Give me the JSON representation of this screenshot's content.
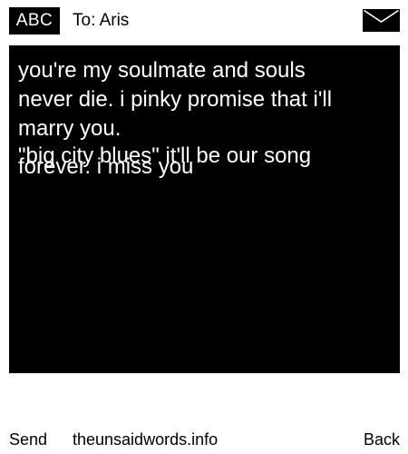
{
  "header": {
    "input_mode": "ABC",
    "recipient": "To: Aris"
  },
  "message": {
    "line_1": "you're my soulmate and souls",
    "line_2": "never die. i pinky promise that i'll",
    "line_3": "marry you.",
    "line_4": "forever. i miss you",
    "overlap_line": "\"big city blues\" it'll be our song"
  },
  "footer": {
    "send_label": "Send",
    "site": "theunsaidwords.info",
    "back_label": "Back"
  },
  "icons": {
    "envelope": "envelope-icon"
  },
  "colors": {
    "background": "#ffffff",
    "message_bg": "#000000",
    "message_text": "#ffffff",
    "badge_bg": "#000000"
  }
}
